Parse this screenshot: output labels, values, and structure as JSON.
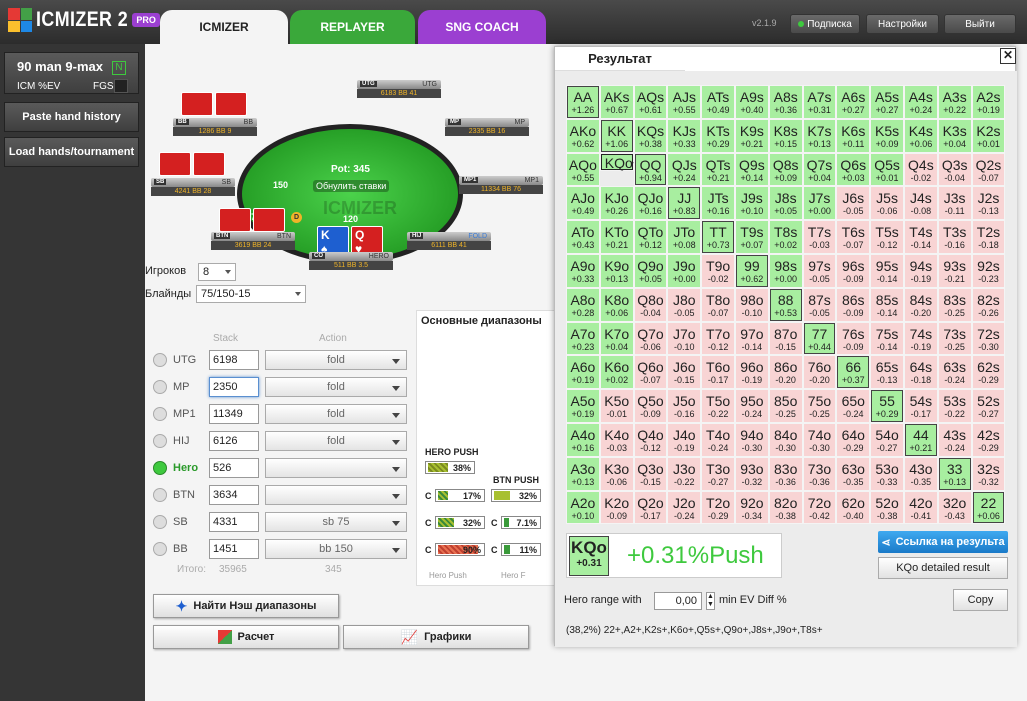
{
  "app": {
    "logo_text": "ICMIZER 2",
    "pro": "PRO",
    "version": "v2.1.9"
  },
  "tabs": [
    "ICMIZER",
    "REPLAYER",
    "SNG COACH"
  ],
  "top_buttons": {
    "subscription": "Подписка",
    "settings": "Настройки",
    "exit": "Выйти"
  },
  "sidebar": {
    "game_title": "90 man 9-max",
    "n_badge": "N",
    "icm_label": "ICM %EV",
    "fgs_label": "FGS",
    "paste": "Paste hand history",
    "load": "Load hands/tournament"
  },
  "table": {
    "pot": "Pot: 345",
    "reset": "Обнулить ставки",
    "watermark": "ICMIZER",
    "seats": [
      {
        "pos": "UTG",
        "name": "UTG",
        "stack": "6183 BB 41"
      },
      {
        "pos": "MP",
        "name": "MP",
        "stack": "2335 BB 16"
      },
      {
        "pos": "MP1",
        "name": "MP1",
        "stack": "11334 BB 76"
      },
      {
        "pos": "HIJ",
        "name": "FOLD",
        "stack": "6111 BB 41"
      },
      {
        "pos": "CO",
        "name": "HERO",
        "stack": "511 BB 3.5"
      },
      {
        "pos": "BTN",
        "name": "BTN",
        "stack": "3619 BB 24"
      },
      {
        "pos": "SB",
        "name": "SB",
        "stack": "4241 BB 28"
      },
      {
        "pos": "BB",
        "name": "BB",
        "stack": "1286 BB 9"
      }
    ],
    "chip_bb": "150",
    "chip_sb": "75",
    "chip_hero": "120",
    "dealer": "D",
    "hero_cards": [
      {
        "r": "K",
        "s": "♠"
      },
      {
        "r": "Q",
        "s": "♥"
      }
    ]
  },
  "controls": {
    "players_label": "Игроков",
    "players_value": "8",
    "blinds_label": "Блайнды",
    "blinds_value": "75/150-15"
  },
  "stack_header": "Stack",
  "action_header": "Action",
  "players": [
    {
      "name": "UTG",
      "stack": "6198",
      "action": "fold"
    },
    {
      "name": "MP",
      "stack": "2350",
      "action": "fold"
    },
    {
      "name": "MP1",
      "stack": "11349",
      "action": "fold"
    },
    {
      "name": "HIJ",
      "stack": "6126",
      "action": "fold"
    },
    {
      "name": "Hero",
      "stack": "526",
      "action": ""
    },
    {
      "name": "BTN",
      "stack": "3634",
      "action": ""
    },
    {
      "name": "SB",
      "stack": "4331",
      "action": "sb 75"
    },
    {
      "name": "BB",
      "stack": "1451",
      "action": "bb 150"
    }
  ],
  "totals": {
    "label": "Итого:",
    "stack": "35965",
    "action": "345"
  },
  "buttons": {
    "nash": "Найти Нэш диапазоны",
    "calc": "Расчет",
    "graphs": "Графики"
  },
  "ranges": {
    "title": "Основные диапазоны",
    "hero_push_title": "HERO PUSH",
    "hero_push": "38%",
    "btn_push_title": "BTN PUSH",
    "btn_push": "32%",
    "c1": "17%",
    "c2": "32%",
    "c3": "90%",
    "c4": "7.1%",
    "c5": "11%",
    "c_label": "C",
    "footer1": "Hero Push",
    "footer2": "Hero F"
  },
  "result": {
    "title": "Результат",
    "close": "✕",
    "selected": {
      "hand": "KQo",
      "ev": "+0.31",
      "value": "+0.31%Push"
    },
    "link_btn": "Ссылка на результа",
    "detail_btn": "KQo detailed result",
    "copy_btn": "Copy",
    "hr_label": "Hero range with",
    "hr_value": "0,00",
    "hr_suffix": "min EV Diff %",
    "range_text": "(38,2%) 22+,A2+,K2s+,K6o+,Q5s+,Q9o+,J8s+,J9o+,T8s+",
    "grid": [
      [
        "AA",
        "+1.26"
      ],
      [
        "AKs",
        "+0.67"
      ],
      [
        "AQs",
        "+0.61"
      ],
      [
        "AJs",
        "+0.55"
      ],
      [
        "ATs",
        "+0.49"
      ],
      [
        "A9s",
        "+0.40"
      ],
      [
        "A8s",
        "+0.36"
      ],
      [
        "A7s",
        "+0.31"
      ],
      [
        "A6s",
        "+0.27"
      ],
      [
        "A5s",
        "+0.27"
      ],
      [
        "A4s",
        "+0.24"
      ],
      [
        "A3s",
        "+0.22"
      ],
      [
        "A2s",
        "+0.19"
      ],
      [
        "AKo",
        "+0.62"
      ],
      [
        "KK",
        "+1.06"
      ],
      [
        "KQs",
        "+0.38"
      ],
      [
        "KJs",
        "+0.33"
      ],
      [
        "KTs",
        "+0.29"
      ],
      [
        "K9s",
        "+0.21"
      ],
      [
        "K8s",
        "+0.15"
      ],
      [
        "K7s",
        "+0.13"
      ],
      [
        "K6s",
        "+0.11"
      ],
      [
        "K5s",
        "+0.09"
      ],
      [
        "K4s",
        "+0.06"
      ],
      [
        "K3s",
        "+0.04"
      ],
      [
        "K2s",
        "+0.01"
      ],
      [
        "AQo",
        "+0.55"
      ],
      [
        "KQo",
        "+0.31"
      ],
      [
        "QQ",
        "+0.94"
      ],
      [
        "QJs",
        "+0.24"
      ],
      [
        "QTs",
        "+0.21"
      ],
      [
        "Q9s",
        "+0.14"
      ],
      [
        "Q8s",
        "+0.09"
      ],
      [
        "Q7s",
        "+0.04"
      ],
      [
        "Q6s",
        "+0.03"
      ],
      [
        "Q5s",
        "+0.01"
      ],
      [
        "Q4s",
        "-0.02"
      ],
      [
        "Q3s",
        "-0.04"
      ],
      [
        "Q2s",
        "-0.07"
      ],
      [
        "AJo",
        "+0.49"
      ],
      [
        "KJo",
        "+0.26"
      ],
      [
        "QJo",
        "+0.16"
      ],
      [
        "JJ",
        "+0.83"
      ],
      [
        "JTs",
        "+0.16"
      ],
      [
        "J9s",
        "+0.10"
      ],
      [
        "J8s",
        "+0.05"
      ],
      [
        "J7s",
        "+0.00"
      ],
      [
        "J6s",
        "-0.05"
      ],
      [
        "J5s",
        "-0.06"
      ],
      [
        "J4s",
        "-0.08"
      ],
      [
        "J3s",
        "-0.11"
      ],
      [
        "J2s",
        "-0.13"
      ],
      [
        "ATo",
        "+0.43"
      ],
      [
        "KTo",
        "+0.21"
      ],
      [
        "QTo",
        "+0.12"
      ],
      [
        "JTo",
        "+0.08"
      ],
      [
        "TT",
        "+0.73"
      ],
      [
        "T9s",
        "+0.07"
      ],
      [
        "T8s",
        "+0.02"
      ],
      [
        "T7s",
        "-0.03"
      ],
      [
        "T6s",
        "-0.07"
      ],
      [
        "T5s",
        "-0.12"
      ],
      [
        "T4s",
        "-0.14"
      ],
      [
        "T3s",
        "-0.16"
      ],
      [
        "T2s",
        "-0.18"
      ],
      [
        "A9o",
        "+0.33"
      ],
      [
        "K9o",
        "+0.13"
      ],
      [
        "Q9o",
        "+0.05"
      ],
      [
        "J9o",
        "+0.00"
      ],
      [
        "T9o",
        "-0.02"
      ],
      [
        "99",
        "+0.62"
      ],
      [
        "98s",
        "+0.00"
      ],
      [
        "97s",
        "-0.05"
      ],
      [
        "96s",
        "-0.09"
      ],
      [
        "95s",
        "-0.14"
      ],
      [
        "94s",
        "-0.19"
      ],
      [
        "93s",
        "-0.21"
      ],
      [
        "92s",
        "-0.23"
      ],
      [
        "A8o",
        "+0.28"
      ],
      [
        "K8o",
        "+0.06"
      ],
      [
        "Q8o",
        "-0.04"
      ],
      [
        "J8o",
        "-0.05"
      ],
      [
        "T8o",
        "-0.07"
      ],
      [
        "98o",
        "-0.10"
      ],
      [
        "88",
        "+0.53"
      ],
      [
        "87s",
        "-0.05"
      ],
      [
        "86s",
        "-0.09"
      ],
      [
        "85s",
        "-0.14"
      ],
      [
        "84s",
        "-0.20"
      ],
      [
        "83s",
        "-0.25"
      ],
      [
        "82s",
        "-0.26"
      ],
      [
        "A7o",
        "+0.23"
      ],
      [
        "K7o",
        "+0.04"
      ],
      [
        "Q7o",
        "-0.06"
      ],
      [
        "J7o",
        "-0.10"
      ],
      [
        "T7o",
        "-0.12"
      ],
      [
        "97o",
        "-0.14"
      ],
      [
        "87o",
        "-0.15"
      ],
      [
        "77",
        "+0.44"
      ],
      [
        "76s",
        "-0.09"
      ],
      [
        "75s",
        "-0.14"
      ],
      [
        "74s",
        "-0.19"
      ],
      [
        "73s",
        "-0.25"
      ],
      [
        "72s",
        "-0.30"
      ],
      [
        "A6o",
        "+0.19"
      ],
      [
        "K6o",
        "+0.02"
      ],
      [
        "Q6o",
        "-0.07"
      ],
      [
        "J6o",
        "-0.15"
      ],
      [
        "T6o",
        "-0.17"
      ],
      [
        "96o",
        "-0.19"
      ],
      [
        "86o",
        "-0.20"
      ],
      [
        "76o",
        "-0.20"
      ],
      [
        "66",
        "+0.37"
      ],
      [
        "65s",
        "-0.13"
      ],
      [
        "64s",
        "-0.18"
      ],
      [
        "63s",
        "-0.24"
      ],
      [
        "62s",
        "-0.29"
      ],
      [
        "A5o",
        "+0.19"
      ],
      [
        "K5o",
        "-0.01"
      ],
      [
        "Q5o",
        "-0.09"
      ],
      [
        "J5o",
        "-0.16"
      ],
      [
        "T5o",
        "-0.22"
      ],
      [
        "95o",
        "-0.24"
      ],
      [
        "85o",
        "-0.25"
      ],
      [
        "75o",
        "-0.25"
      ],
      [
        "65o",
        "-0.24"
      ],
      [
        "55",
        "+0.29"
      ],
      [
        "54s",
        "-0.17"
      ],
      [
        "53s",
        "-0.22"
      ],
      [
        "52s",
        "-0.27"
      ],
      [
        "A4o",
        "+0.16"
      ],
      [
        "K4o",
        "-0.03"
      ],
      [
        "Q4o",
        "-0.12"
      ],
      [
        "J4o",
        "-0.19"
      ],
      [
        "T4o",
        "-0.24"
      ],
      [
        "94o",
        "-0.30"
      ],
      [
        "84o",
        "-0.30"
      ],
      [
        "74o",
        "-0.30"
      ],
      [
        "64o",
        "-0.29"
      ],
      [
        "54o",
        "-0.27"
      ],
      [
        "44",
        "+0.21"
      ],
      [
        "43s",
        "-0.24"
      ],
      [
        "42s",
        "-0.29"
      ],
      [
        "A3o",
        "+0.13"
      ],
      [
        "K3o",
        "-0.06"
      ],
      [
        "Q3o",
        "-0.15"
      ],
      [
        "J3o",
        "-0.22"
      ],
      [
        "T3o",
        "-0.27"
      ],
      [
        "93o",
        "-0.32"
      ],
      [
        "83o",
        "-0.36"
      ],
      [
        "73o",
        "-0.36"
      ],
      [
        "63o",
        "-0.35"
      ],
      [
        "53o",
        "-0.33"
      ],
      [
        "43o",
        "-0.35"
      ],
      [
        "33",
        "+0.13"
      ],
      [
        "32s",
        "-0.32"
      ],
      [
        "A2o",
        "+0.10"
      ],
      [
        "K2o",
        "-0.09"
      ],
      [
        "Q2o",
        "-0.17"
      ],
      [
        "J2o",
        "-0.24"
      ],
      [
        "T2o",
        "-0.29"
      ],
      [
        "92o",
        "-0.34"
      ],
      [
        "82o",
        "-0.38"
      ],
      [
        "72o",
        "-0.42"
      ],
      [
        "62o",
        "-0.40"
      ],
      [
        "52o",
        "-0.38"
      ],
      [
        "42o",
        "-0.41"
      ],
      [
        "32o",
        "-0.43"
      ],
      [
        "22",
        "+0.06"
      ]
    ]
  },
  "colors": {
    "push": "#a8eea0",
    "fold": "#f8d4d4",
    "accent": "#3ec93e"
  }
}
